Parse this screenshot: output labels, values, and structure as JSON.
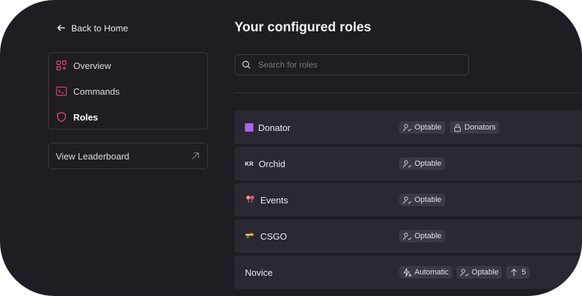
{
  "nav": {
    "back_label": "Back to Home",
    "items": [
      {
        "label": "Overview",
        "icon": "grid-icon"
      },
      {
        "label": "Commands",
        "icon": "terminal-icon"
      },
      {
        "label": "Roles",
        "icon": "shield-icon",
        "active": true
      }
    ],
    "leaderboard_label": "View Leaderboard"
  },
  "main": {
    "title": "Your configured roles",
    "search": {
      "placeholder": "Search for roles",
      "value": ""
    },
    "roles": [
      {
        "name": "Donator",
        "icon": "purple-square-icon",
        "tags": [
          "Optable",
          "Donators"
        ]
      },
      {
        "name": "Orchid",
        "icon": "kr-flag-icon",
        "tags": [
          "Optable"
        ]
      },
      {
        "name": "Events",
        "icon": "party-icon",
        "tags": [
          "Optable"
        ]
      },
      {
        "name": "CSGO",
        "icon": "gun-icon",
        "tags": [
          "Optable"
        ]
      },
      {
        "name": "Novice",
        "icon": "",
        "tags": [
          "Automatic",
          "Optable",
          "5"
        ]
      }
    ]
  },
  "colors": {
    "background": "#1e1d24",
    "row": "#2a2931",
    "tag": "#3b3a43",
    "accent_pink": "#e0457b",
    "donator": "#b061f5"
  }
}
